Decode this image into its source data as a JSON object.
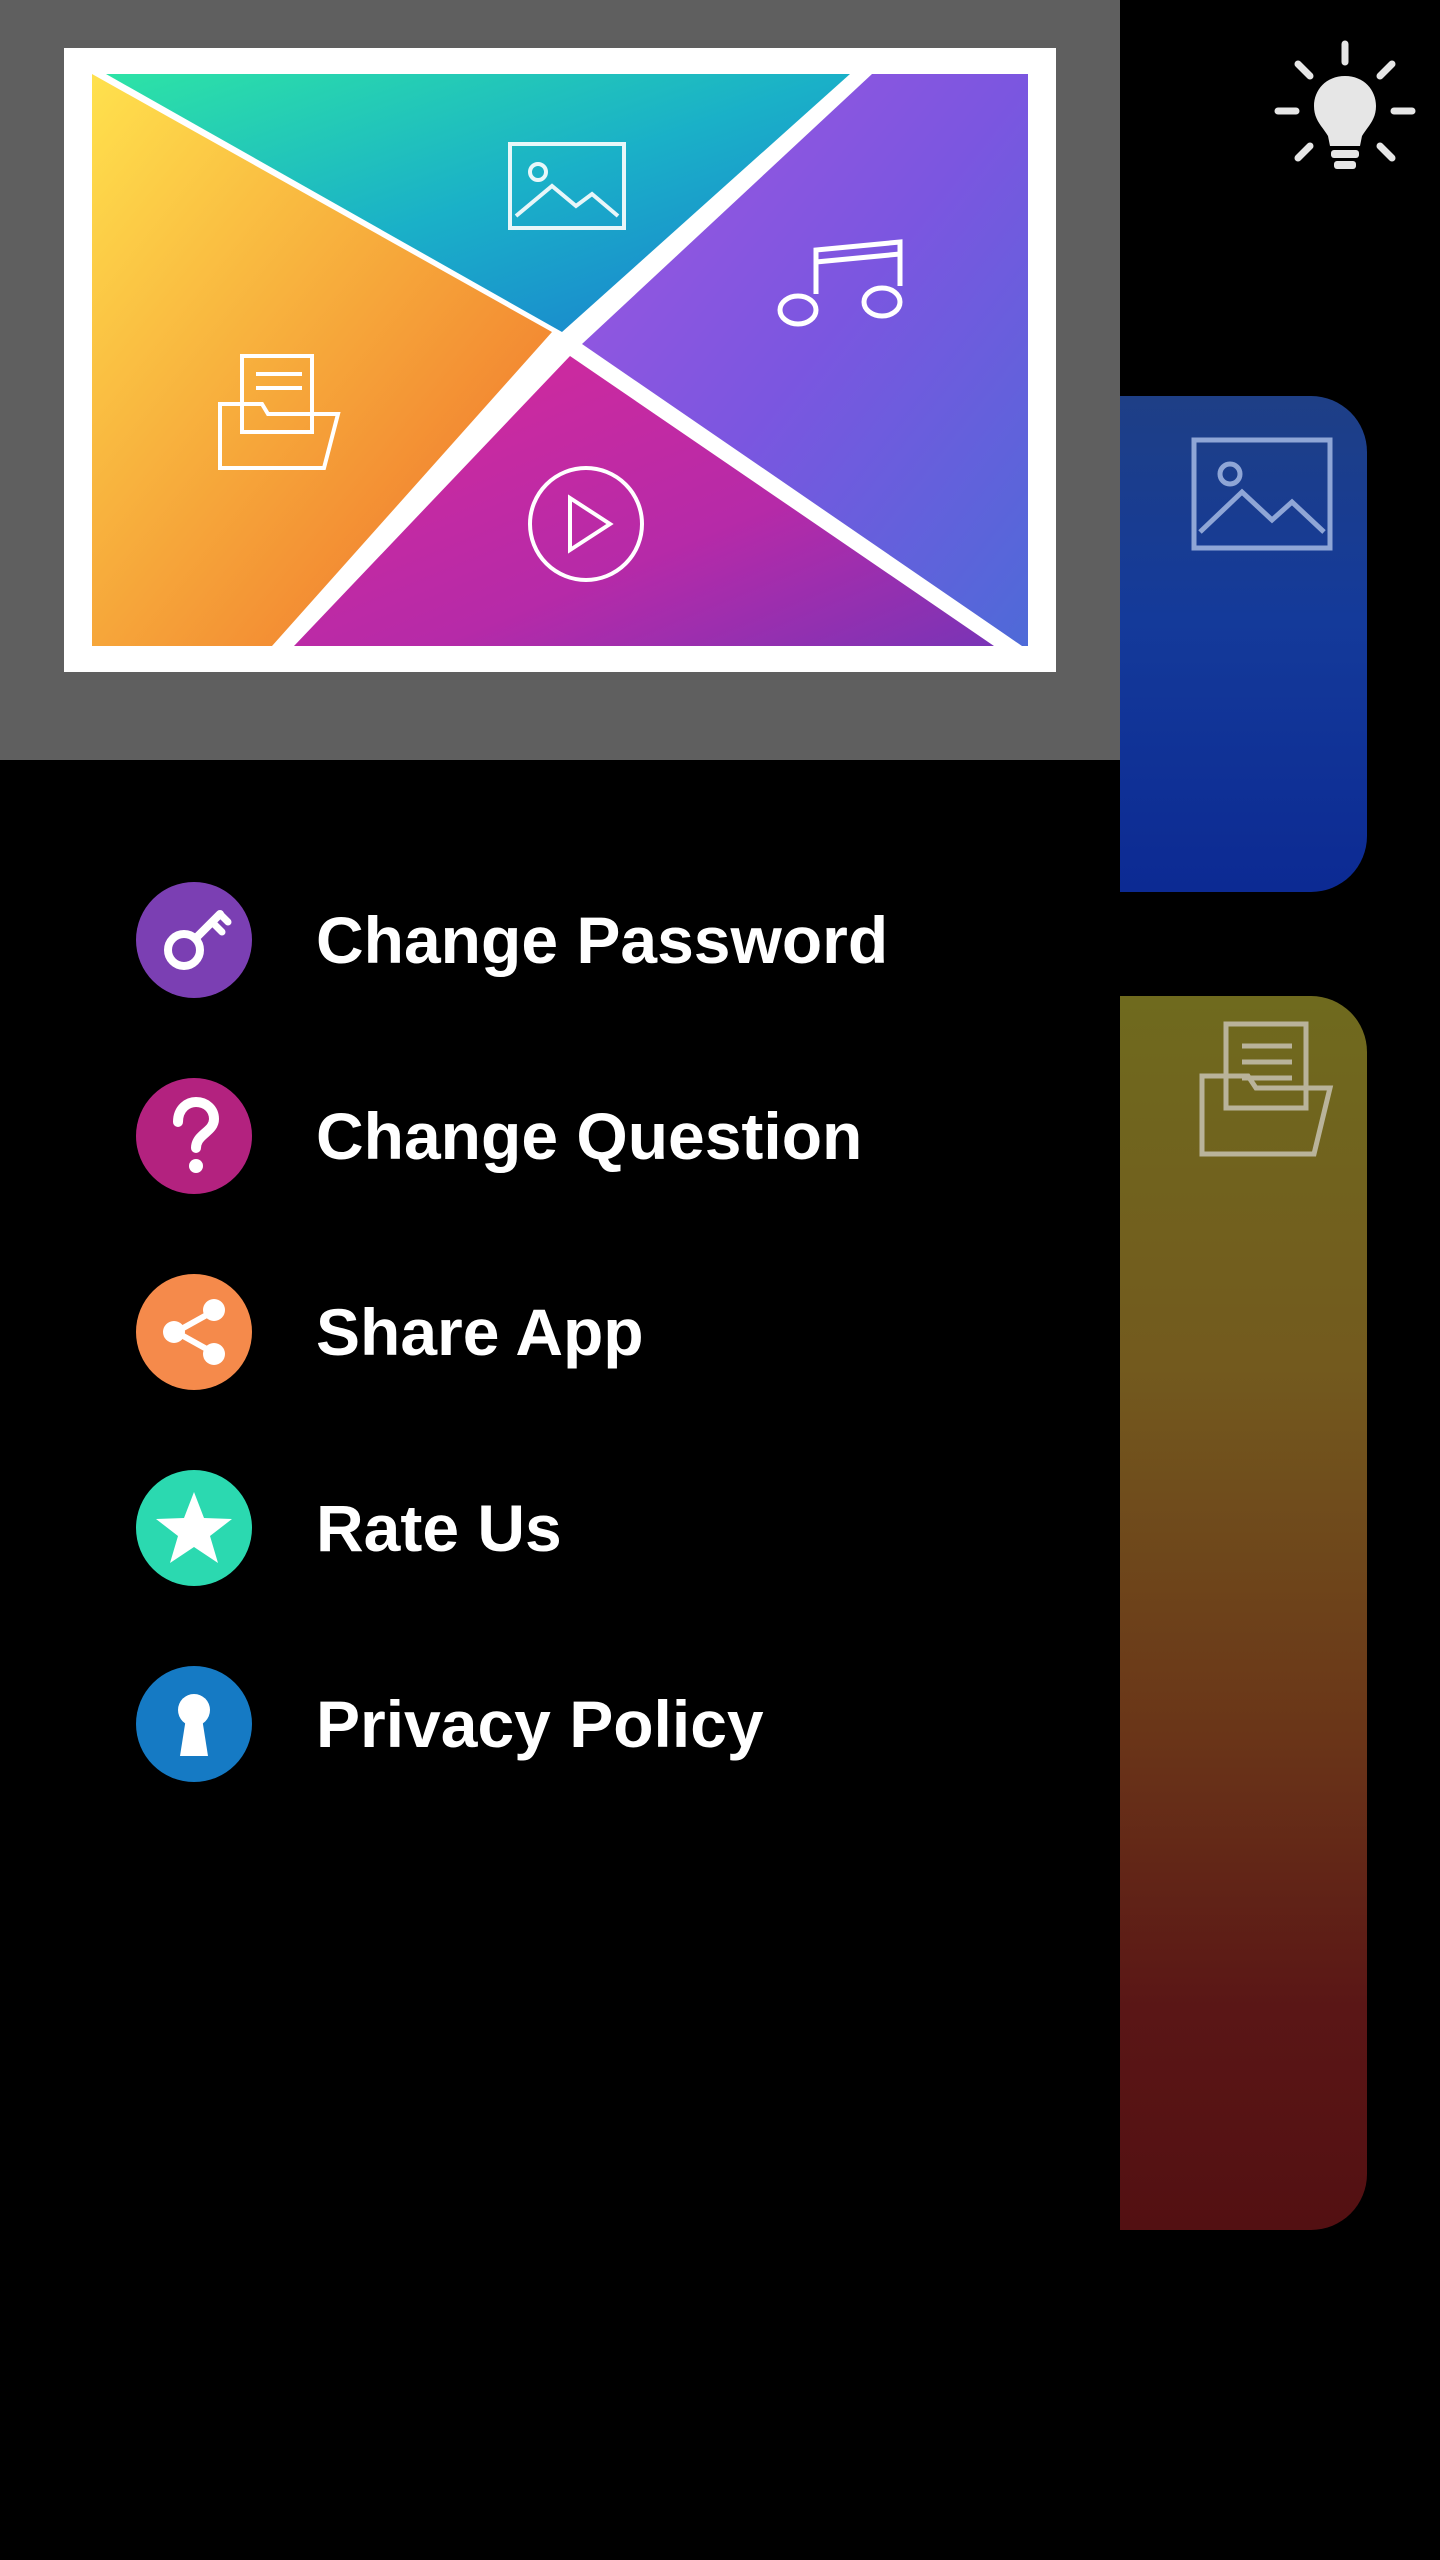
{
  "menu": {
    "items": [
      {
        "label": "Change Password",
        "icon": "key-icon",
        "color": "#7b3fb3"
      },
      {
        "label": "Change Question",
        "icon": "question-icon",
        "color": "#b3227f"
      },
      {
        "label": "Share App",
        "icon": "share-icon",
        "color": "#f58a4b"
      },
      {
        "label": "Rate Us",
        "icon": "star-icon",
        "color": "#2bd9b0"
      },
      {
        "label": "Privacy Policy",
        "icon": "keyhole-icon",
        "color": "#157ac4"
      }
    ]
  },
  "background": {
    "cards": [
      {
        "icon": "image-icon",
        "color": "#143a9a"
      },
      {
        "icon": "folder-icon",
        "color": "#6a3518"
      }
    ],
    "theme_toggle_icon": "lightbulb-icon"
  },
  "header": {
    "banner_icons": [
      "image-icon",
      "music-note-icon",
      "folder-icon",
      "play-icon"
    ]
  }
}
